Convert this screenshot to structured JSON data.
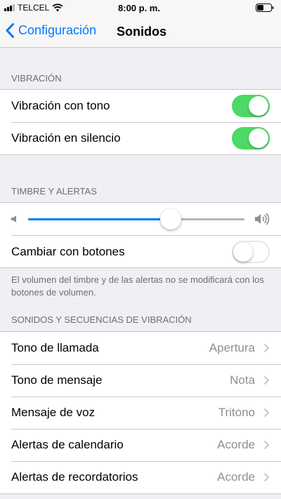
{
  "status_bar": {
    "carrier": "TELCEL",
    "time": "8:00 p. m.",
    "signal_bars": 4,
    "signal_bars_filled": 3
  },
  "nav": {
    "back_label": "Configuración",
    "title": "Sonidos",
    "accent_color": "#007aff"
  },
  "vibration": {
    "header": "VIBRACIÓN",
    "rows": [
      {
        "label": "Vibración con tono",
        "on": true
      },
      {
        "label": "Vibración en silencio",
        "on": true
      }
    ]
  },
  "ringer": {
    "header": "TIMBRE Y ALERTAS",
    "volume_level": 0.66,
    "change_with_buttons_label": "Cambiar con botones",
    "change_with_buttons_on": false,
    "footer": "El volumen del timbre y de las alertas no se modificará con los botones de volumen."
  },
  "sounds": {
    "header": "SONIDOS Y SECUENCIAS DE VIBRACIÓN",
    "rows": [
      {
        "label": "Tono de llamada",
        "value": "Apertura"
      },
      {
        "label": "Tono de mensaje",
        "value": "Nota"
      },
      {
        "label": "Mensaje de voz",
        "value": "Tritono"
      },
      {
        "label": "Alertas de calendario",
        "value": "Acorde"
      },
      {
        "label": "Alertas de recordatorios",
        "value": "Acorde"
      }
    ]
  },
  "colors": {
    "toggle_on": "#4cd964",
    "background": "#efeff4"
  }
}
